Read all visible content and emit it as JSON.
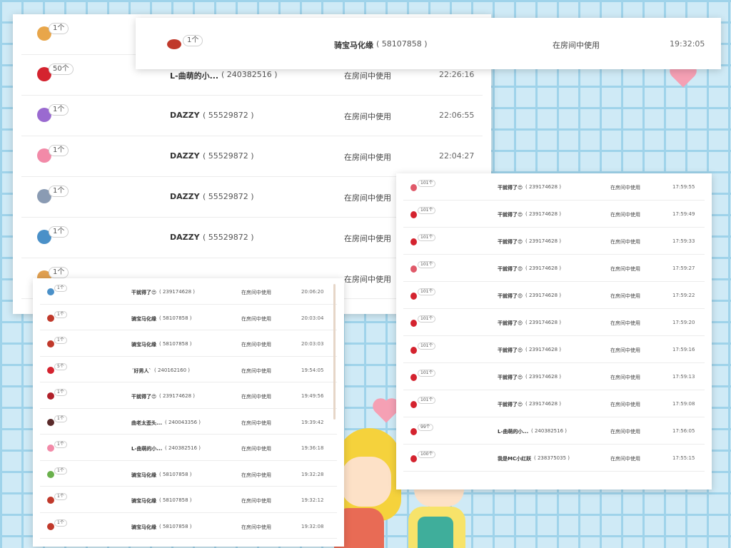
{
  "colors": {
    "background": "#cfeaf6",
    "grid": "#9fd3ea",
    "panel": "#ffffff",
    "heart": "#f5a0b4"
  },
  "panel_a": {
    "rows": [
      {
        "icon": "necklace-gift-icon",
        "color": "#e8a64a",
        "count": "1个",
        "name": "",
        "uid": "",
        "status": "",
        "time": ""
      },
      {
        "icon": "rose-gift-icon",
        "color": "#d4232f",
        "count": "50个",
        "name": "L-曲萌的小...",
        "uid": "( 240382516 )",
        "status": "在房间中使用",
        "time": "22:26:16"
      },
      {
        "icon": "ring-gift-icon",
        "color": "#9a6ad0",
        "count": "1个",
        "name": "DAZZY",
        "uid": "( 55529872 )",
        "status": "在房间中使用",
        "time": "22:06:55"
      },
      {
        "icon": "heart-card-gift-icon",
        "color": "#f28aa8",
        "count": "1个",
        "name": "DAZZY",
        "uid": "( 55529872 )",
        "status": "在房间中使用",
        "time": "22:04:27"
      },
      {
        "icon": "swords-gift-icon",
        "color": "#8a9bb3",
        "count": "1个",
        "name": "DAZZY",
        "uid": "( 55529872 )",
        "status": "在房间中使用",
        "time": ""
      },
      {
        "icon": "ufo-gift-icon",
        "color": "#4a90c8",
        "count": "1个",
        "name": "DAZZY",
        "uid": "( 55529872 )",
        "status": "在房间中使用",
        "time": ""
      },
      {
        "icon": "gift-icon",
        "color": "#e0a050",
        "count": "1个",
        "name": "",
        "uid": "",
        "status": "在房间中使用",
        "time": ""
      }
    ]
  },
  "panel_b": {
    "rows": [
      {
        "icon": "carriage-gift-icon",
        "color": "#c0392b",
        "count": "1个",
        "name": "骑宝马化缘",
        "uid": "( 58107858 )",
        "status": "在房间中使用",
        "time": "19:32:05"
      }
    ]
  },
  "panel_c": {
    "rows": [
      {
        "icon": "ufo-gift-icon",
        "color": "#4a90c8",
        "count": "1个",
        "name": "干就得了😍",
        "uid": "( 239174628 )",
        "status": "在房间中使用",
        "time": "20:06:20"
      },
      {
        "icon": "carriage-gift-icon",
        "color": "#c0392b",
        "count": "1个",
        "name": "骑宝马化缘",
        "uid": "( 58107858 )",
        "status": "在房间中使用",
        "time": "20:03:04"
      },
      {
        "icon": "carriage-gift-icon",
        "color": "#c0392b",
        "count": "1个",
        "name": "骑宝马化缘",
        "uid": "( 58107858 )",
        "status": "在房间中使用",
        "time": "20:03:03"
      },
      {
        "icon": "rose-gift-icon",
        "color": "#d4232f",
        "count": "5个",
        "name": "ˊ好男人ˋ",
        "uid": "( 240162160 )",
        "status": "在房间中使用",
        "time": "19:54:05"
      },
      {
        "icon": "lips-gift-icon",
        "color": "#b0202a",
        "count": "1个",
        "name": "干就得了😍",
        "uid": "( 239174628 )",
        "status": "在房间中使用",
        "time": "19:49:56"
      },
      {
        "icon": "bear-gift-icon",
        "color": "#5a2a2a",
        "count": "1个",
        "name": "曲老太歪头...",
        "uid": "( 240043356 )",
        "status": "在房间中使用",
        "time": "19:39:42"
      },
      {
        "icon": "heart-card-gift-icon",
        "color": "#f28aa8",
        "count": "1个",
        "name": "L-曲萌的小...",
        "uid": "( 240382516 )",
        "status": "在房间中使用",
        "time": "19:36:18"
      },
      {
        "icon": "clock-gift-icon",
        "color": "#6ab04c",
        "count": "1个",
        "name": "骑宝马化缘",
        "uid": "( 58107858 )",
        "status": "在房间中使用",
        "time": "19:32:28"
      },
      {
        "icon": "carriage-gift-icon",
        "color": "#c0392b",
        "count": "1个",
        "name": "骑宝马化缘",
        "uid": "( 58107858 )",
        "status": "在房间中使用",
        "time": "19:32:12"
      },
      {
        "icon": "carriage-gift-icon",
        "color": "#c0392b",
        "count": "1个",
        "name": "骑宝马化缘",
        "uid": "( 58107858 )",
        "status": "在房间中使用",
        "time": "19:32:08"
      }
    ]
  },
  "panel_d": {
    "rows": [
      {
        "icon": "rose-gift-icon",
        "color": "#e05a6a",
        "count": "101个",
        "name": "干就得了😍",
        "uid": "( 239174628 )",
        "status": "在房间中使用",
        "time": "17:59:55"
      },
      {
        "icon": "rose-gift-icon",
        "color": "#d4232f",
        "count": "101个",
        "name": "干就得了😍",
        "uid": "( 239174628 )",
        "status": "在房间中使用",
        "time": "17:59:49"
      },
      {
        "icon": "rose-gift-icon",
        "color": "#d4232f",
        "count": "101个",
        "name": "干就得了😍",
        "uid": "( 239174628 )",
        "status": "在房间中使用",
        "time": "17:59:33"
      },
      {
        "icon": "rose-gift-icon",
        "color": "#e05a6a",
        "count": "101个",
        "name": "干就得了😍",
        "uid": "( 239174628 )",
        "status": "在房间中使用",
        "time": "17:59:27"
      },
      {
        "icon": "rose-gift-icon",
        "color": "#d4232f",
        "count": "101个",
        "name": "干就得了😍",
        "uid": "( 239174628 )",
        "status": "在房间中使用",
        "time": "17:59:22"
      },
      {
        "icon": "rose-gift-icon",
        "color": "#d4232f",
        "count": "101个",
        "name": "干就得了😍",
        "uid": "( 239174628 )",
        "status": "在房间中使用",
        "time": "17:59:20"
      },
      {
        "icon": "rose-gift-icon",
        "color": "#d4232f",
        "count": "101个",
        "name": "干就得了😍",
        "uid": "( 239174628 )",
        "status": "在房间中使用",
        "time": "17:59:16"
      },
      {
        "icon": "rose-gift-icon",
        "color": "#d4232f",
        "count": "101个",
        "name": "干就得了😍",
        "uid": "( 239174628 )",
        "status": "在房间中使用",
        "time": "17:59:13"
      },
      {
        "icon": "rose-gift-icon",
        "color": "#d4232f",
        "count": "101个",
        "name": "干就得了😍",
        "uid": "( 239174628 )",
        "status": "在房间中使用",
        "time": "17:59:08"
      },
      {
        "icon": "rose-gift-icon",
        "color": "#d4232f",
        "count": "99个",
        "name": "L-曲萌的小...",
        "uid": "( 240382516 )",
        "status": "在房间中使用",
        "time": "17:56:05"
      },
      {
        "icon": "rose-gift-icon",
        "color": "#d4232f",
        "count": "100个",
        "name": "我是MC小红跃",
        "uid": "( 238375035 )",
        "status": "在房间中使用",
        "time": "17:55:15"
      }
    ]
  }
}
